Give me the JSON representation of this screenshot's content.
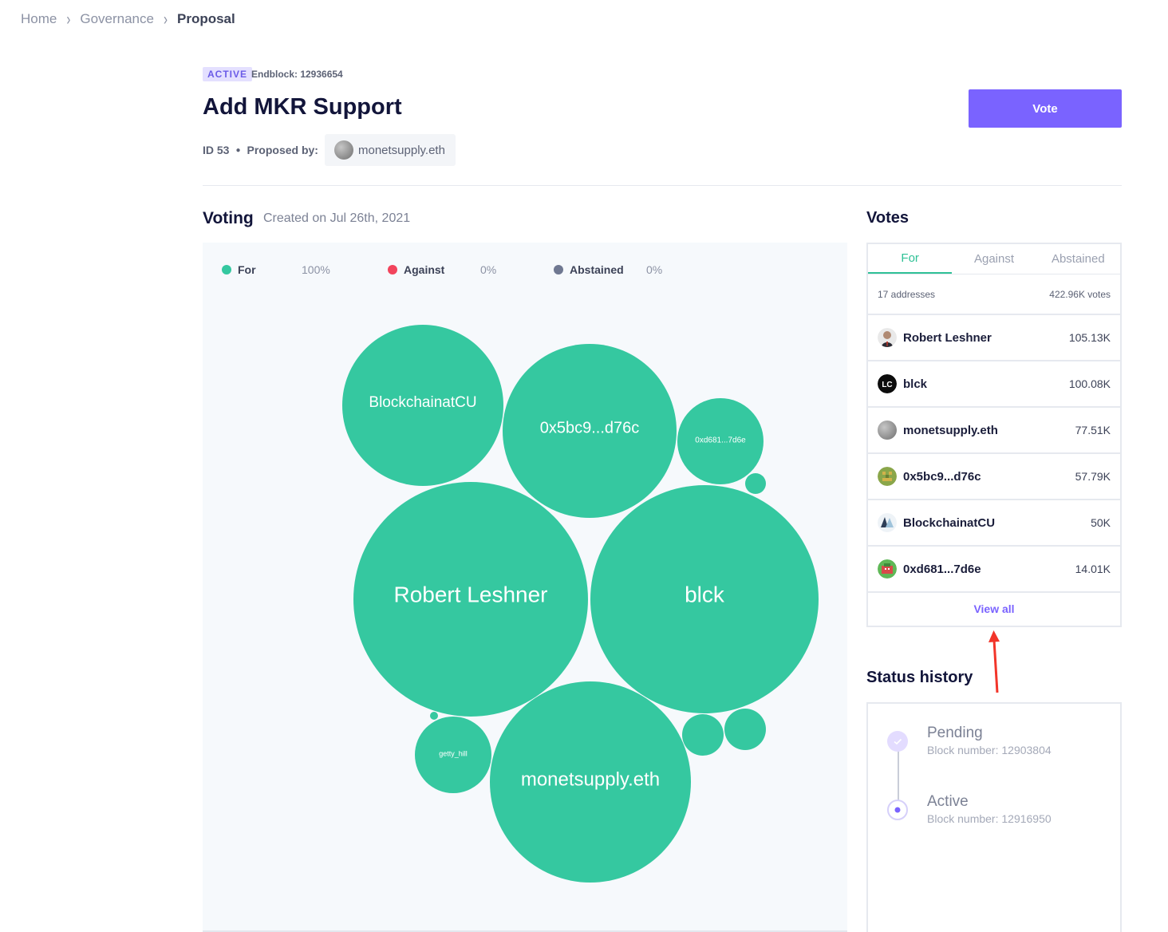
{
  "breadcrumb": {
    "items": [
      "Home",
      "Governance",
      "Proposal"
    ]
  },
  "proposal": {
    "status_badge": "ACTIVE",
    "endblock": "Endblock: 12936654",
    "title": "Add MKR Support",
    "id_label": "ID 53",
    "proposed_by_label": "Proposed by:",
    "proposer": "monetsupply.eth"
  },
  "vote_button": "Vote",
  "voting": {
    "heading": "Voting",
    "created": "Created on Jul 26th, 2021",
    "legend": [
      {
        "label": "For",
        "pct": "100%",
        "color": "#34c8a0"
      },
      {
        "label": "Against",
        "pct": "0%",
        "color": "#f2445c"
      },
      {
        "label": "Abstained",
        "pct": "0%",
        "color": "#6f7891"
      }
    ],
    "bubble_color": "#35c8a0",
    "bubbles": [
      {
        "label": "BlockchainatCU",
        "votes": 50000
      },
      {
        "label": "0x5bc9...d76c",
        "votes": 57790
      },
      {
        "label": "0xd681...7d6e",
        "votes": 14010
      },
      {
        "label": "Robert Leshner",
        "votes": 105130
      },
      {
        "label": "blck",
        "votes": 100080
      },
      {
        "label": "getty_hill",
        "votes": 11000
      },
      {
        "label": "monetsupply.eth",
        "votes": 77510
      }
    ]
  },
  "votes": {
    "heading": "Votes",
    "tabs": [
      "For",
      "Against",
      "Abstained"
    ],
    "address_count": "17 addresses",
    "total_votes": "422.96K votes",
    "voters": [
      {
        "name": "Robert Leshner",
        "amount": "105.13K",
        "avatar": "person-avatar"
      },
      {
        "name": "blck",
        "amount": "100.08K",
        "avatar": "blck-logo-avatar"
      },
      {
        "name": "monetsupply.eth",
        "amount": "77.51K",
        "avatar": "gray-avatar"
      },
      {
        "name": "0x5bc9...d76c",
        "amount": "57.79K",
        "avatar": "pixel-avatar"
      },
      {
        "name": "BlockchainatCU",
        "amount": "50K",
        "avatar": "cu-logo-avatar"
      },
      {
        "name": "0xd681...7d6e",
        "amount": "14.01K",
        "avatar": "pixel-avatar-red"
      }
    ],
    "view_all": "View all"
  },
  "status_history": {
    "heading": "Status history",
    "steps": [
      {
        "name": "Pending",
        "block": "Block number: 12903804"
      },
      {
        "name": "Active",
        "block": "Block number: 12916950"
      }
    ]
  }
}
